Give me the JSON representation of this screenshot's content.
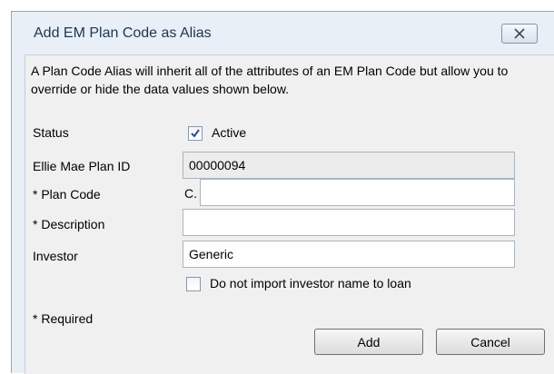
{
  "dialog": {
    "title": "Add EM Plan Code as Alias",
    "description": "A Plan Code Alias will inherit all of the attributes of an EM Plan Code but allow you to override or hide the data values shown below."
  },
  "form": {
    "status_label": "Status",
    "active_label": "Active",
    "active_checked": true,
    "plan_id_label": "Ellie Mae Plan ID",
    "plan_id_value": "00000094",
    "plan_code_label": "* Plan Code",
    "plan_code_prefix": "C.",
    "plan_code_value": "",
    "description_label": "* Description",
    "description_value": "",
    "investor_label": "Investor",
    "investor_value": "Generic",
    "no_import_label": "Do not import investor name to loan",
    "no_import_checked": false,
    "required_note": "* Required"
  },
  "buttons": {
    "add": "Add",
    "cancel": "Cancel"
  },
  "icons": {
    "close": "close-icon",
    "checkmark": "checkmark-icon"
  },
  "colors": {
    "title_text": "#1e3550",
    "checkmark": "#2a4f9a"
  }
}
